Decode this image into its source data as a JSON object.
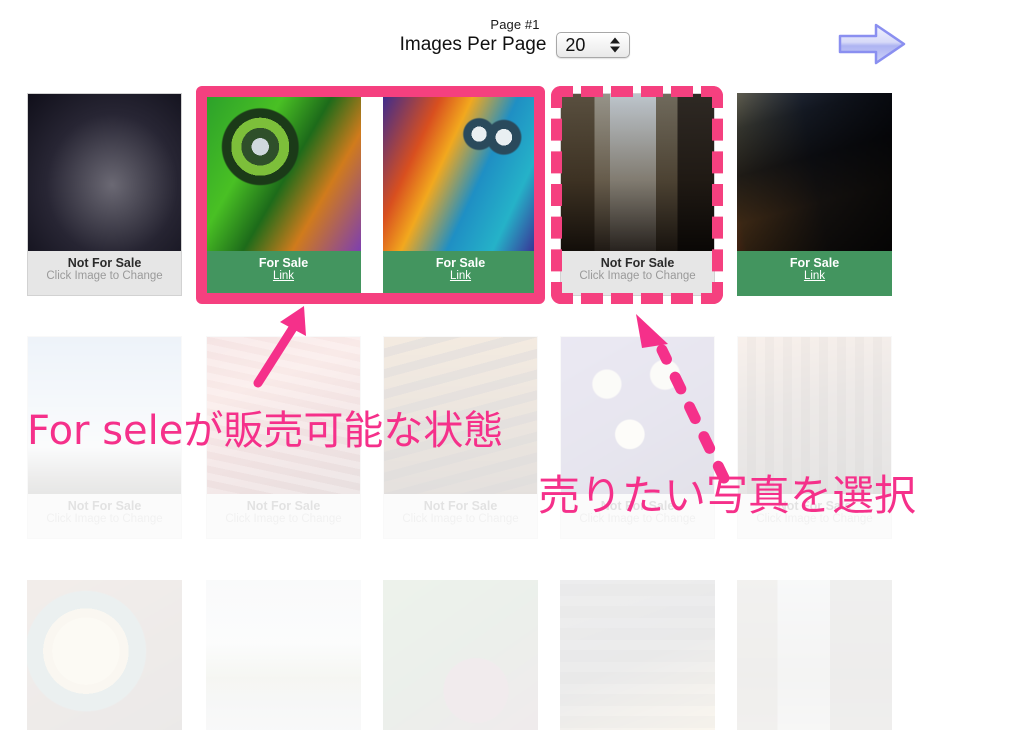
{
  "header": {
    "page_label": "Page #1",
    "images_per_page_label": "Images Per Page",
    "images_per_page_value": "20",
    "next_page_icon": "right-arrow-icon"
  },
  "labels": {
    "not_for_sale": "Not For Sale",
    "click_to_change": "Click Image to Change",
    "for_sale": "For Sale",
    "link": "Link"
  },
  "colors": {
    "for_sale_green": "#43955f",
    "not_for_sale_gray": "#e6e6e6",
    "annotation_pink": "#f5308a",
    "selection_pink": "#f5407f",
    "next_arrow_blue": "#8a8ff0"
  },
  "annotations": [
    {
      "id": "ann-1",
      "text": "For seleが販売可能な状態",
      "arrow": "solid-arrow-up-right"
    },
    {
      "id": "ann-2",
      "text": "売りたい写真を選択",
      "arrow": "dashed-arrow-up-left"
    }
  ],
  "grid": {
    "rows": [
      {
        "row": 1,
        "faded": false,
        "cards": [
          {
            "subject": "winged-statue",
            "status": "Not For Sale",
            "sub": "Click Image to Change"
          },
          {
            "subject": "green-monster-graffiti",
            "status": "For Sale",
            "sub": "Link"
          },
          {
            "subject": "blue-monster-graffiti",
            "status": "For Sale",
            "sub": "Link"
          },
          {
            "subject": "laneway-alley",
            "status": "Not For Sale",
            "sub": "Click Image to Change"
          },
          {
            "subject": "flinders-street-station",
            "status": "For Sale",
            "sub": "Link"
          }
        ]
      },
      {
        "row": 2,
        "faded": true,
        "cards": [
          {
            "subject": "cloudy-sky-powerlines",
            "status": "Not For Sale",
            "sub": "Click Image to Change"
          },
          {
            "subject": "market-meat-stall",
            "status": "Not For Sale",
            "sub": "Click Image to Change"
          },
          {
            "subject": "chocolates-tray",
            "status": "Not For Sale",
            "sub": "Click Image to Change"
          },
          {
            "subject": "oysters-purple-tray",
            "status": "Not For Sale",
            "sub": "Click Image to Change"
          },
          {
            "subject": "dark-city-building",
            "status": "Not For Sale",
            "sub": "Click Image to Change"
          }
        ]
      },
      {
        "row": 3,
        "faded": true,
        "cards": [
          {
            "subject": "latte-art-coffee",
            "status": "",
            "sub": ""
          },
          {
            "subject": "misty-park-path",
            "status": "",
            "sub": ""
          },
          {
            "subject": "beetroot-greens",
            "status": "",
            "sub": ""
          },
          {
            "subject": "night-building-lights",
            "status": "",
            "sub": ""
          },
          {
            "subject": "cobbled-alley",
            "status": "",
            "sub": ""
          }
        ]
      }
    ]
  }
}
